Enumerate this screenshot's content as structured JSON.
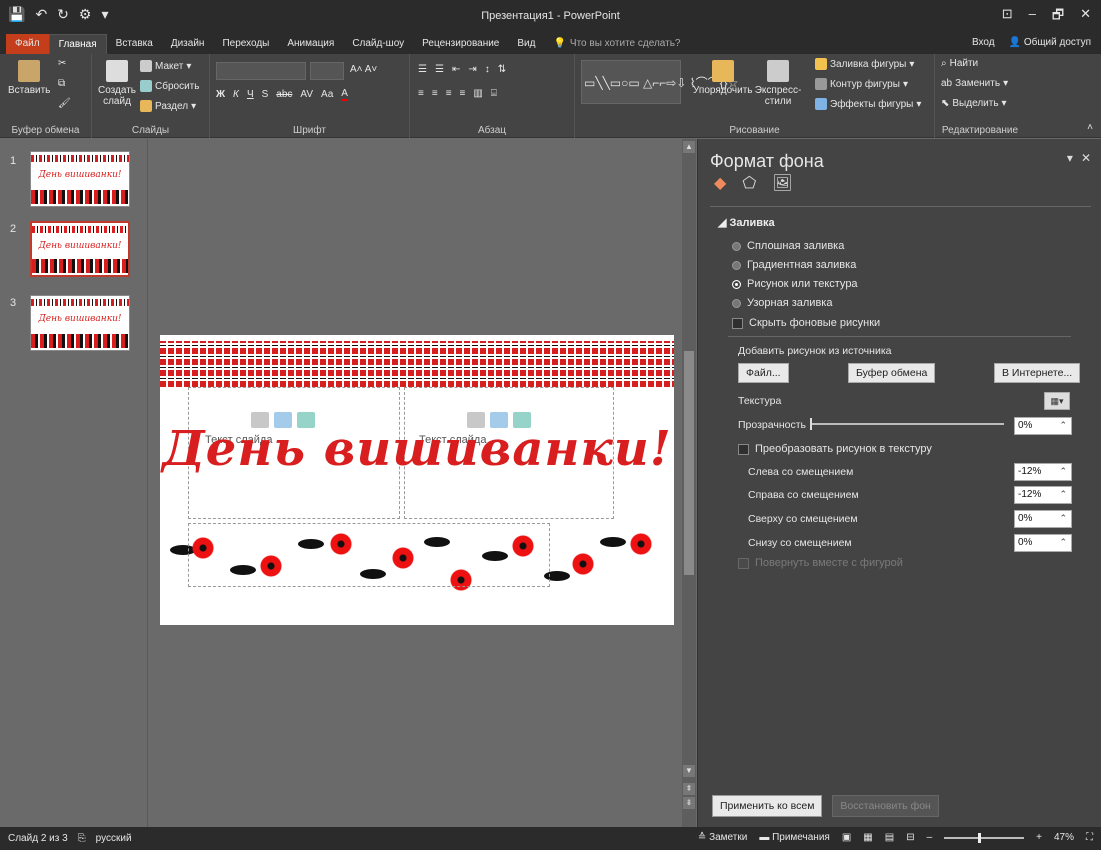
{
  "window": {
    "title": "Презентация1 - PowerPoint",
    "controls": [
      "⊡",
      "–",
      "🗗",
      "✕"
    ]
  },
  "quick_access": [
    "💾",
    "↶",
    "↻",
    "⚙",
    "▾"
  ],
  "tabs": [
    "Файл",
    "Главная",
    "Вставка",
    "Дизайн",
    "Переходы",
    "Анимация",
    "Слайд-шоу",
    "Рецензирование",
    "Вид"
  ],
  "tell_me": "Что вы хотите сделать?",
  "signin": "Вход",
  "share": "Общий доступ",
  "ribbon": {
    "clipboard": {
      "paste": "Вставить",
      "label": "Буфер обмена"
    },
    "slides": {
      "new_slide": "Создать слайд",
      "layout": "Макет",
      "reset": "Сбросить",
      "section": "Раздел",
      "label": "Слайды"
    },
    "font": {
      "label": "Шрифт",
      "bold": "Ж",
      "italic": "К",
      "underline": "Ч",
      "strike": "abc",
      "case": "Aa"
    },
    "paragraph": {
      "label": "Абзац"
    },
    "drawing": {
      "arrange": "Упорядочить",
      "quick_styles": "Экспресс-стили",
      "fill": "Заливка фигуры",
      "outline": "Контур фигуры",
      "effects": "Эффекты фигуры",
      "label": "Рисование"
    },
    "editing": {
      "find": "Найти",
      "replace": "Заменить",
      "select": "Выделить",
      "label": "Редактирование"
    }
  },
  "thumbnails": [
    {
      "num": "1",
      "title": "День вишиванки!",
      "selected": false
    },
    {
      "num": "2",
      "title": "День вишиванки!",
      "selected": true
    },
    {
      "num": "3",
      "title": "День вишиванки!",
      "selected": false
    }
  ],
  "slide": {
    "title": "День вишиванки!",
    "placeholder_left": "Текст слайда",
    "placeholder_right": "Текст слайда"
  },
  "pane": {
    "title": "Формат фона",
    "section": "Заливка",
    "fill_options": [
      {
        "label": "Сплошная заливка",
        "checked": false
      },
      {
        "label": "Градиентная заливка",
        "checked": false
      },
      {
        "label": "Рисунок или текстура",
        "checked": true
      },
      {
        "label": "Узорная заливка",
        "checked": false
      }
    ],
    "hide_bg": "Скрыть фоновые рисунки",
    "insert_from": "Добавить рисунок из источника",
    "btn_file": "Файл...",
    "btn_clipboard": "Буфер обмена",
    "btn_online": "В Интернете...",
    "texture": "Текстура",
    "transparency": "Прозрачность",
    "transparency_value": "0%",
    "tile": "Преобразовать рисунок в текстуру",
    "offsets": [
      {
        "label": "Слева со смещением",
        "value": "-12%"
      },
      {
        "label": "Справа со смещением",
        "value": "-12%"
      },
      {
        "label": "Сверху со смещением",
        "value": "0%"
      },
      {
        "label": "Снизу со смещением",
        "value": "0%"
      }
    ],
    "rotate": "Повернуть вместе с фигурой",
    "apply_all": "Применить ко всем",
    "reset_bg": "Восстановить фон"
  },
  "status": {
    "slide_info": "Слайд 2 из 3",
    "lang": "русский",
    "notes": "Заметки",
    "comments": "Примечания",
    "zoom": "47%"
  },
  "colors": {
    "accent": "#c43e1c",
    "embroidery_red": "#d81e1e"
  }
}
